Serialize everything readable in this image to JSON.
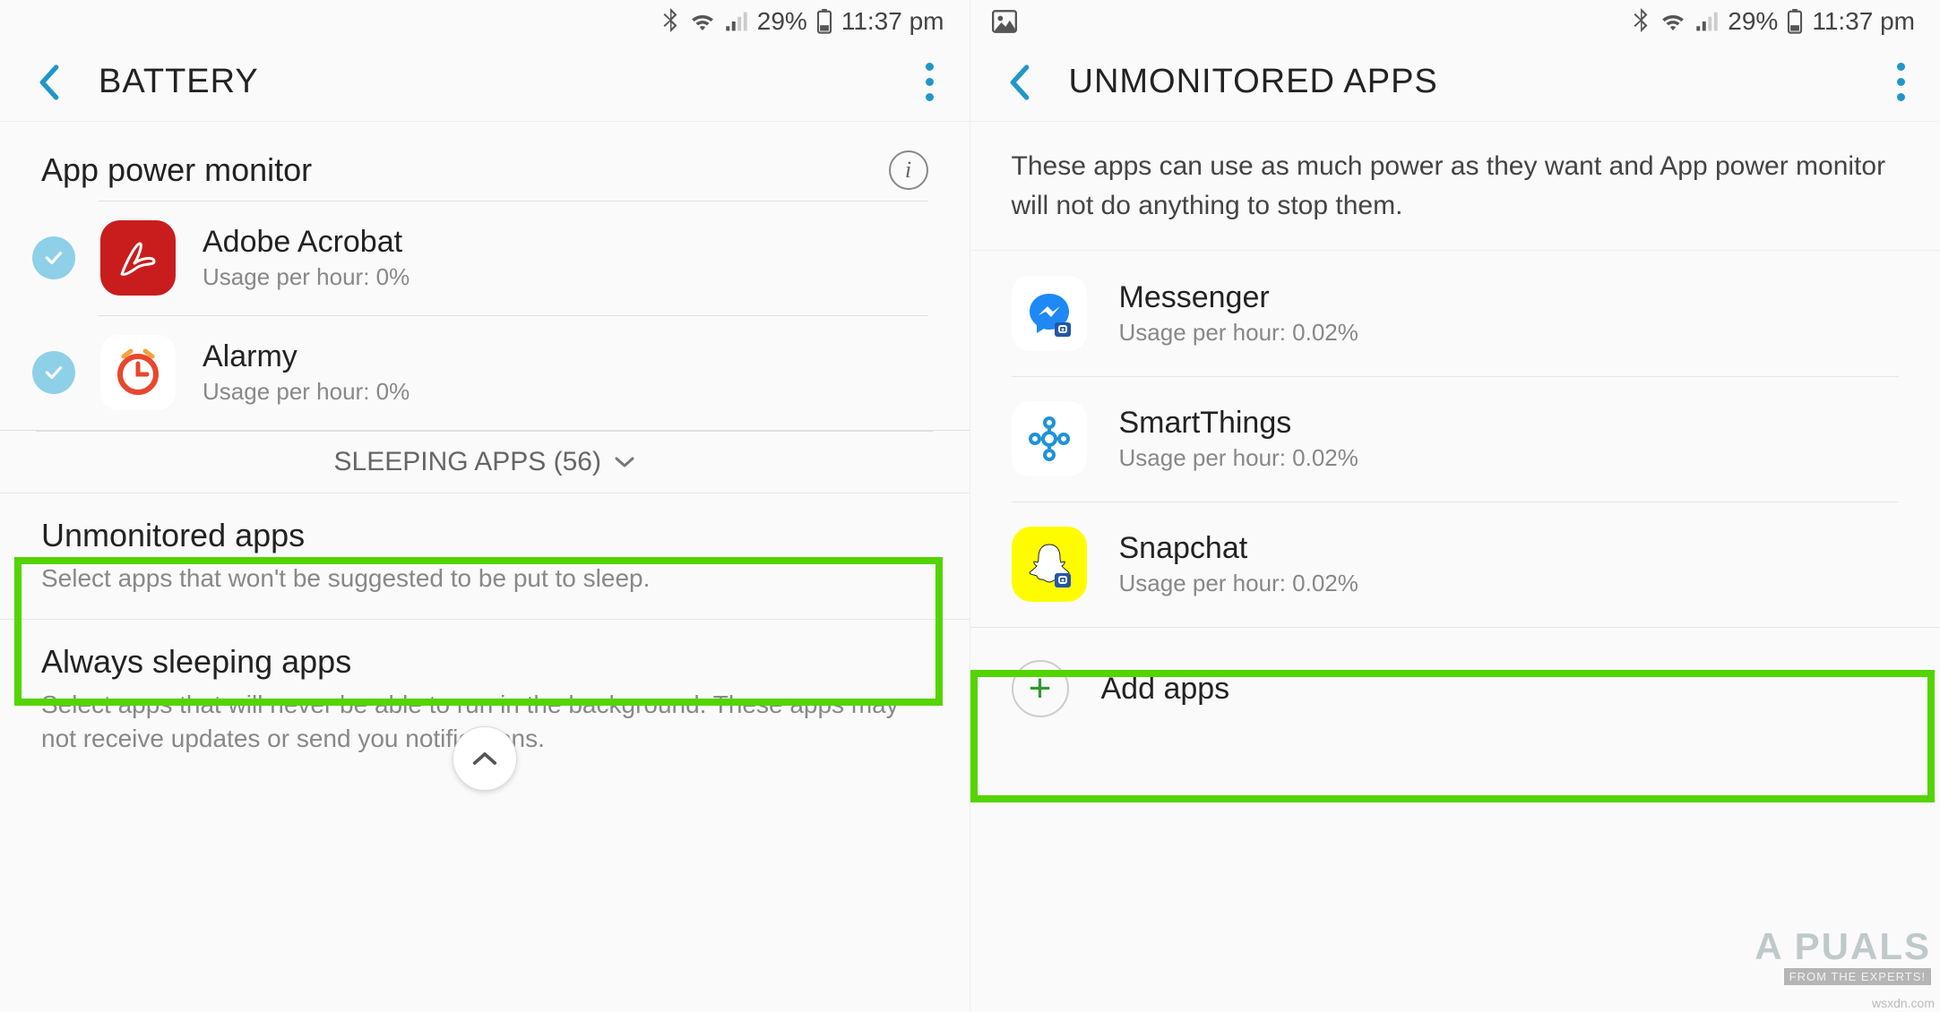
{
  "status": {
    "battery_pct": "29%",
    "time": "11:37 pm"
  },
  "left": {
    "title": "BATTERY",
    "section_title": "App power monitor",
    "apps": [
      {
        "name": "Adobe Acrobat",
        "sub": "Usage per hour: 0%"
      },
      {
        "name": "Alarmy",
        "sub": "Usage per hour: 0%"
      }
    ],
    "sleeping_label": "SLEEPING APPS (56)",
    "unmonitored": {
      "title": "Unmonitored apps",
      "sub": "Select apps that won't be suggested to be put to sleep."
    },
    "always": {
      "title": "Always sleeping apps",
      "sub": "Select apps that will never be able to run in the background. These apps may not receive updates or send you notifications."
    }
  },
  "right": {
    "title": "UNMONITORED APPS",
    "description": "These apps can use as much power as they want and App power monitor will not do anything to stop them.",
    "apps": [
      {
        "name": "Messenger",
        "sub": "Usage per hour: 0.02%"
      },
      {
        "name": "SmartThings",
        "sub": "Usage per hour: 0.02%"
      },
      {
        "name": "Snapchat",
        "sub": "Usage per hour: 0.02%"
      }
    ],
    "add_label": "Add apps"
  },
  "watermark": {
    "source": "wsxdn.com",
    "brand": "A   PUALS",
    "brand_sub": "FROM THE EXPERTS!"
  }
}
